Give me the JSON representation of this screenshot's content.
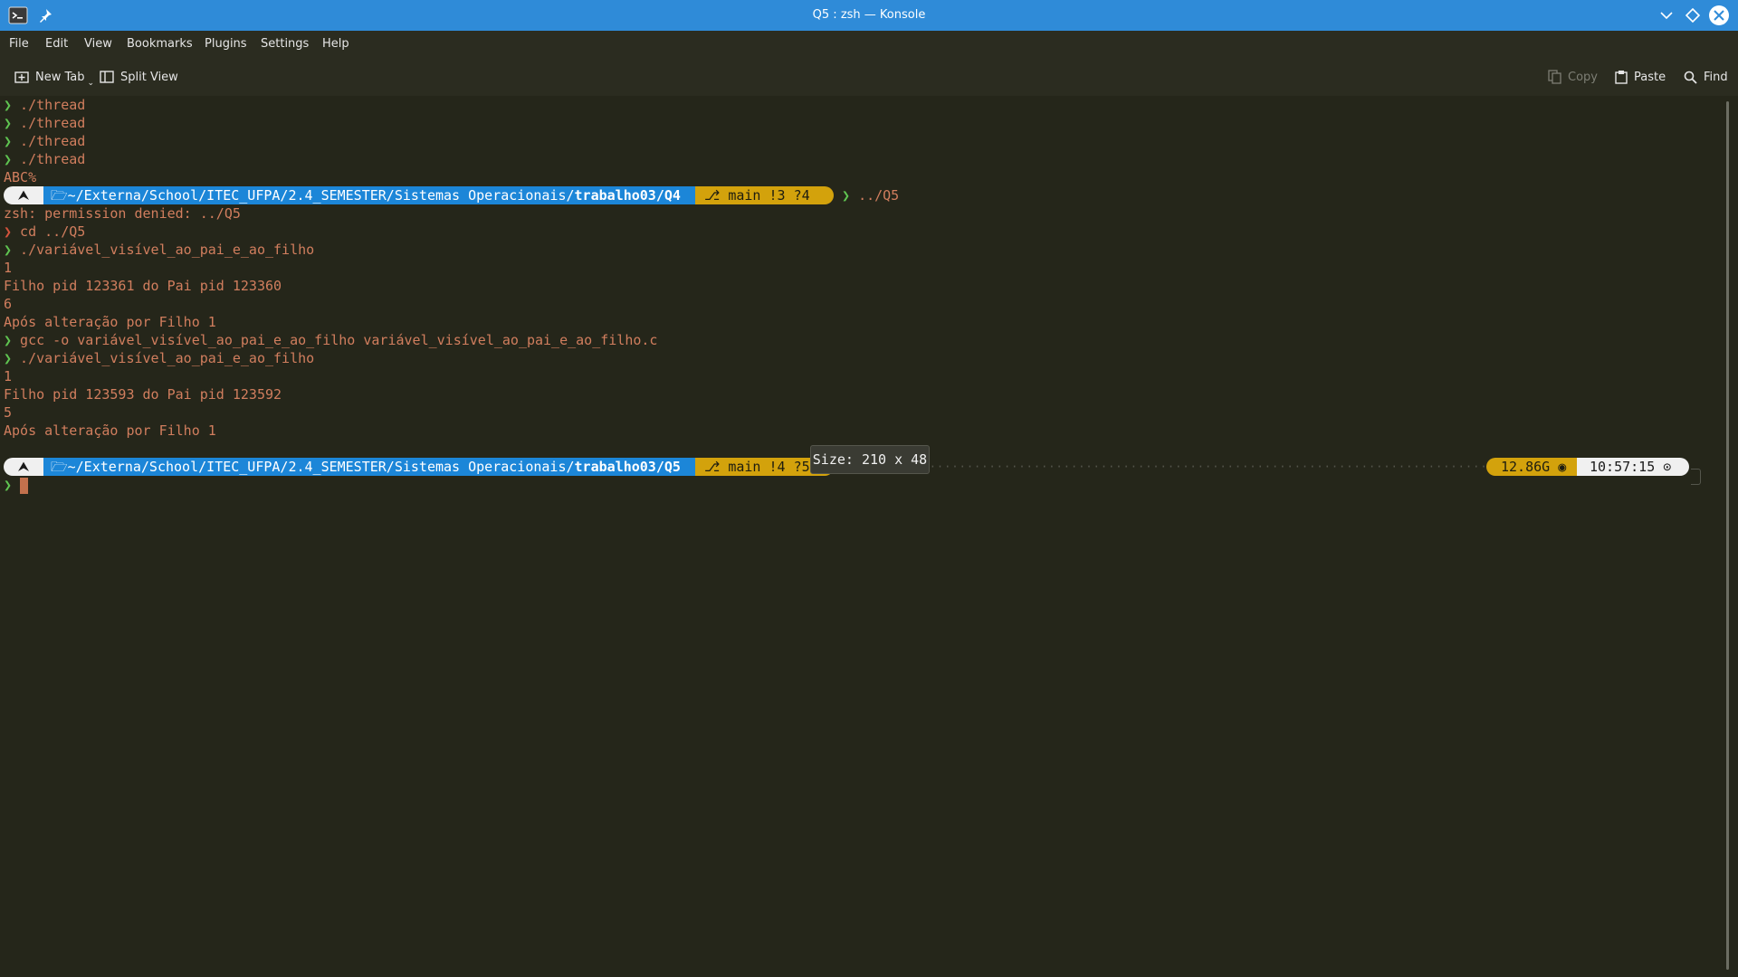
{
  "window": {
    "title": "Q5 : zsh — Konsole",
    "buttons": [
      "minimize-icon",
      "maximize-icon",
      "close-icon"
    ]
  },
  "menu": [
    "File",
    "Edit",
    "View",
    "Bookmarks",
    "Plugins",
    "Settings",
    "Help"
  ],
  "toolbar": {
    "new_tab": "New Tab",
    "split_view": "Split View",
    "copy": "Copy",
    "paste": "Paste",
    "find": "Find"
  },
  "terminal": {
    "lines": [
      {
        "prompt": "❯",
        "text": " ./thread"
      },
      {
        "prompt": "❯",
        "text": " ./thread"
      },
      {
        "prompt": "❯",
        "text": " ./thread"
      },
      {
        "prompt": "❯",
        "text": " ./thread"
      },
      {
        "prompt": "",
        "text": "ABC%"
      }
    ],
    "prompt1": {
      "os_icon": "⮝",
      "dir_prefix": "~/Externa/School/ITEC_UFPA/2.4_SEMESTER/Sistemas Operacionais/",
      "dir_bold": "trabalho03/Q4",
      "git": "main !3 ?4",
      "command": "../Q5"
    },
    "output": [
      {
        "prompt": "",
        "text": "zsh: permission denied: ../Q5"
      },
      {
        "prompt": "❯",
        "prompt_color": "red",
        "text": " cd ../Q5"
      },
      {
        "prompt": "❯",
        "text": " ./variável_visível_ao_pai_e_ao_filho"
      },
      {
        "prompt": "",
        "text": "1"
      },
      {
        "prompt": "",
        "text": "Filho pid 123361 do Pai pid 123360"
      },
      {
        "prompt": "",
        "text": "6"
      },
      {
        "prompt": "",
        "text": "Após alteração por Filho 1"
      },
      {
        "prompt": "❯",
        "text": " gcc -o variável_visível_ao_pai_e_ao_filho variável_visível_ao_pai_e_ao_filho.c"
      },
      {
        "prompt": "❯",
        "text": " ./variável_visível_ao_pai_e_ao_filho"
      },
      {
        "prompt": "",
        "text": "1"
      },
      {
        "prompt": "",
        "text": "Filho pid 123593 do Pai pid 123592"
      },
      {
        "prompt": "",
        "text": "5"
      },
      {
        "prompt": "",
        "text": "Após alteração por Filho 1"
      }
    ],
    "prompt2": {
      "os_icon": "⮝",
      "dir_prefix": "~/Externa/School/ITEC_UFPA/2.4_SEMESTER/Sistemas Operacionais/",
      "dir_bold": "trabalho03/Q5",
      "git": "main !4 ?5",
      "memory": "12.86G",
      "time": "10:57:15"
    },
    "input_prompt": "❯"
  },
  "size_tooltip": "Size: 210 x 48",
  "colors": {
    "background": "#25261a",
    "title_bar": "#2f8bd8",
    "prompt_dir": "#1c86d8",
    "prompt_git": "#d3a20c",
    "output_text": "#d17e5e",
    "prompt_arrow": "#5fc451"
  }
}
